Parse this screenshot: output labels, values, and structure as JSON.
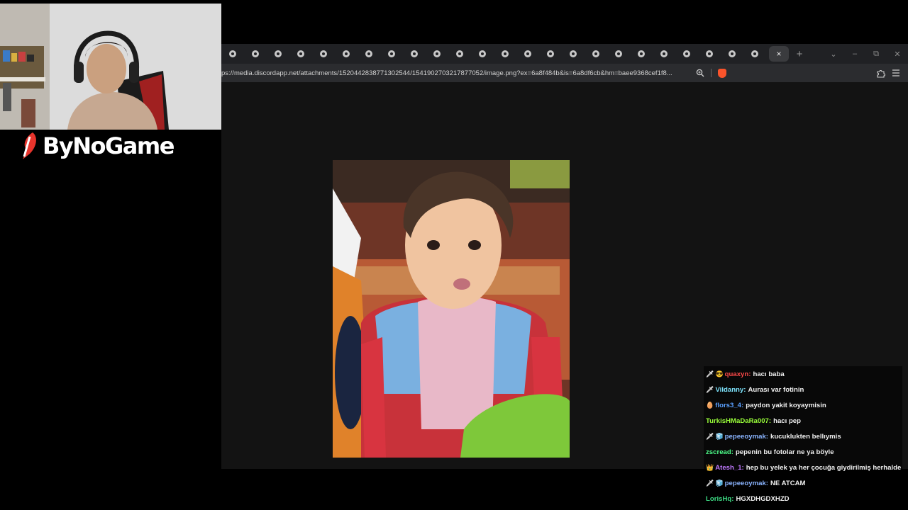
{
  "browser": {
    "tab_count": 24,
    "active_tab_close": "×",
    "new_tab": "+",
    "tab_list": "⌄",
    "window_controls": {
      "minimize": "–",
      "restore": "⧉",
      "close": "✕"
    },
    "url": "ps://media.discordapp.net/attachments/1520442838771302544/1541902703217877052/image.png?ex=6a8f484b&is=6a8df6cb&hm=baee9368cef1f8...",
    "zoom_icon": "zoom-icon",
    "shield_icon": "brave-shield-icon",
    "extensions_icon": "puzzle-icon",
    "menu_icon": "hamburger-menu-icon"
  },
  "stream": {
    "logo_text": "ByNoGame"
  },
  "chat": {
    "messages": [
      {
        "badges": [
          "🗡",
          "😎"
        ],
        "user": "quaxyn",
        "color": "#ff4a4a",
        "text": "hacı baba"
      },
      {
        "badges": [
          "🗡"
        ],
        "user": "Vildanny",
        "color": "#7fe6ff",
        "text": "Aurası var fotinin"
      },
      {
        "badges": [
          "🥚"
        ],
        "user": "flors3_4",
        "color": "#5aa0ff",
        "text": "paydon yakit koyaymisin"
      },
      {
        "badges": [],
        "user": "TurkisHMaDaRa007",
        "color": "#9aff3a",
        "text": "hacı pep"
      },
      {
        "badges": [
          "🗡",
          "🧊"
        ],
        "user": "pepeeoymak",
        "color": "#8ab4ff",
        "text": "kucuklukten bellıymis"
      },
      {
        "badges": [],
        "user": "zscread",
        "color": "#4dff8a",
        "text": "pepenin bu fotolar ne ya böyle"
      },
      {
        "badges": [
          "👑"
        ],
        "user": "Atesh_1",
        "color": "#c07aff",
        "text": "hep bu yelek ya her çocuğa giydirilmiş herhalde"
      },
      {
        "badges": [
          "🗡",
          "🧊"
        ],
        "user": "pepeeoymak",
        "color": "#8ab4ff",
        "text": "NE ATCAM"
      },
      {
        "badges": [],
        "user": "LorisHq",
        "color": "#3ddc84",
        "text": "HGXDHGDXHZD"
      }
    ]
  }
}
